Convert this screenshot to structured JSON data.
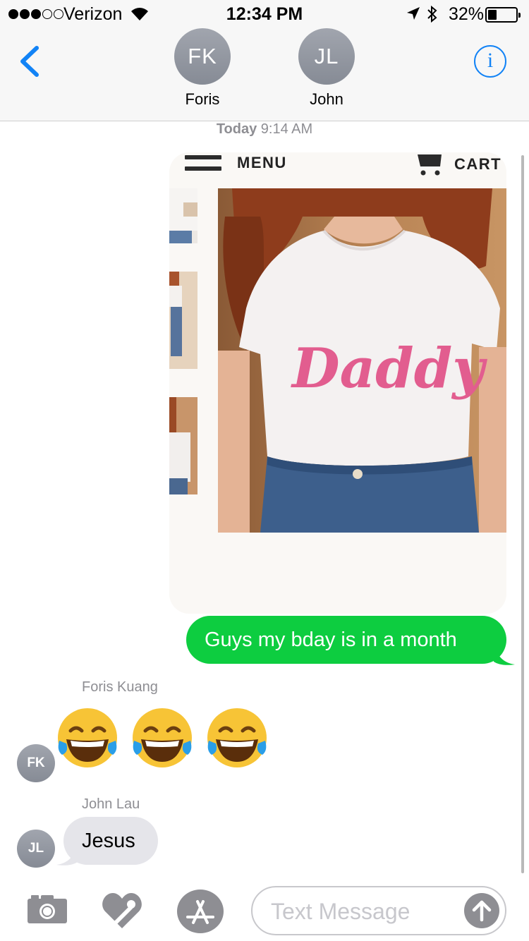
{
  "status_bar": {
    "carrier": "Verizon",
    "time": "12:34 PM",
    "battery_percent": "32%",
    "signal_bars": 3,
    "signal_total": 5,
    "battery_level": 0.32
  },
  "header": {
    "back_icon": "chevron-left-icon",
    "info_icon": "info-circle-icon",
    "info_glyph": "i",
    "accent_color": "#1283f6",
    "contacts": [
      {
        "initials": "FK",
        "name": "Foris"
      },
      {
        "initials": "JL",
        "name": "John"
      }
    ]
  },
  "conversation": {
    "timestamp_day": "Today",
    "timestamp_time": "9:14 AM",
    "image_message": {
      "menu_label": "MENU",
      "cart_label": "CART",
      "shirt_text": "Daddy"
    },
    "sent_message": {
      "text": "Guys my bday is in a month",
      "color": "#0dcd40"
    },
    "emoji_message": {
      "sender": "Foris Kuang",
      "avatar": "FK",
      "emoji": [
        "😂",
        "😂",
        "😂"
      ]
    },
    "received_message": {
      "sender": "John Lau",
      "avatar": "JL",
      "text": "Jesus"
    }
  },
  "input_bar": {
    "placeholder": "Text Message",
    "camera_icon": "camera-icon",
    "digital_touch_icon": "digital-touch-icon",
    "app_store_icon": "app-store-icon",
    "send_icon": "send-arrow-icon"
  }
}
